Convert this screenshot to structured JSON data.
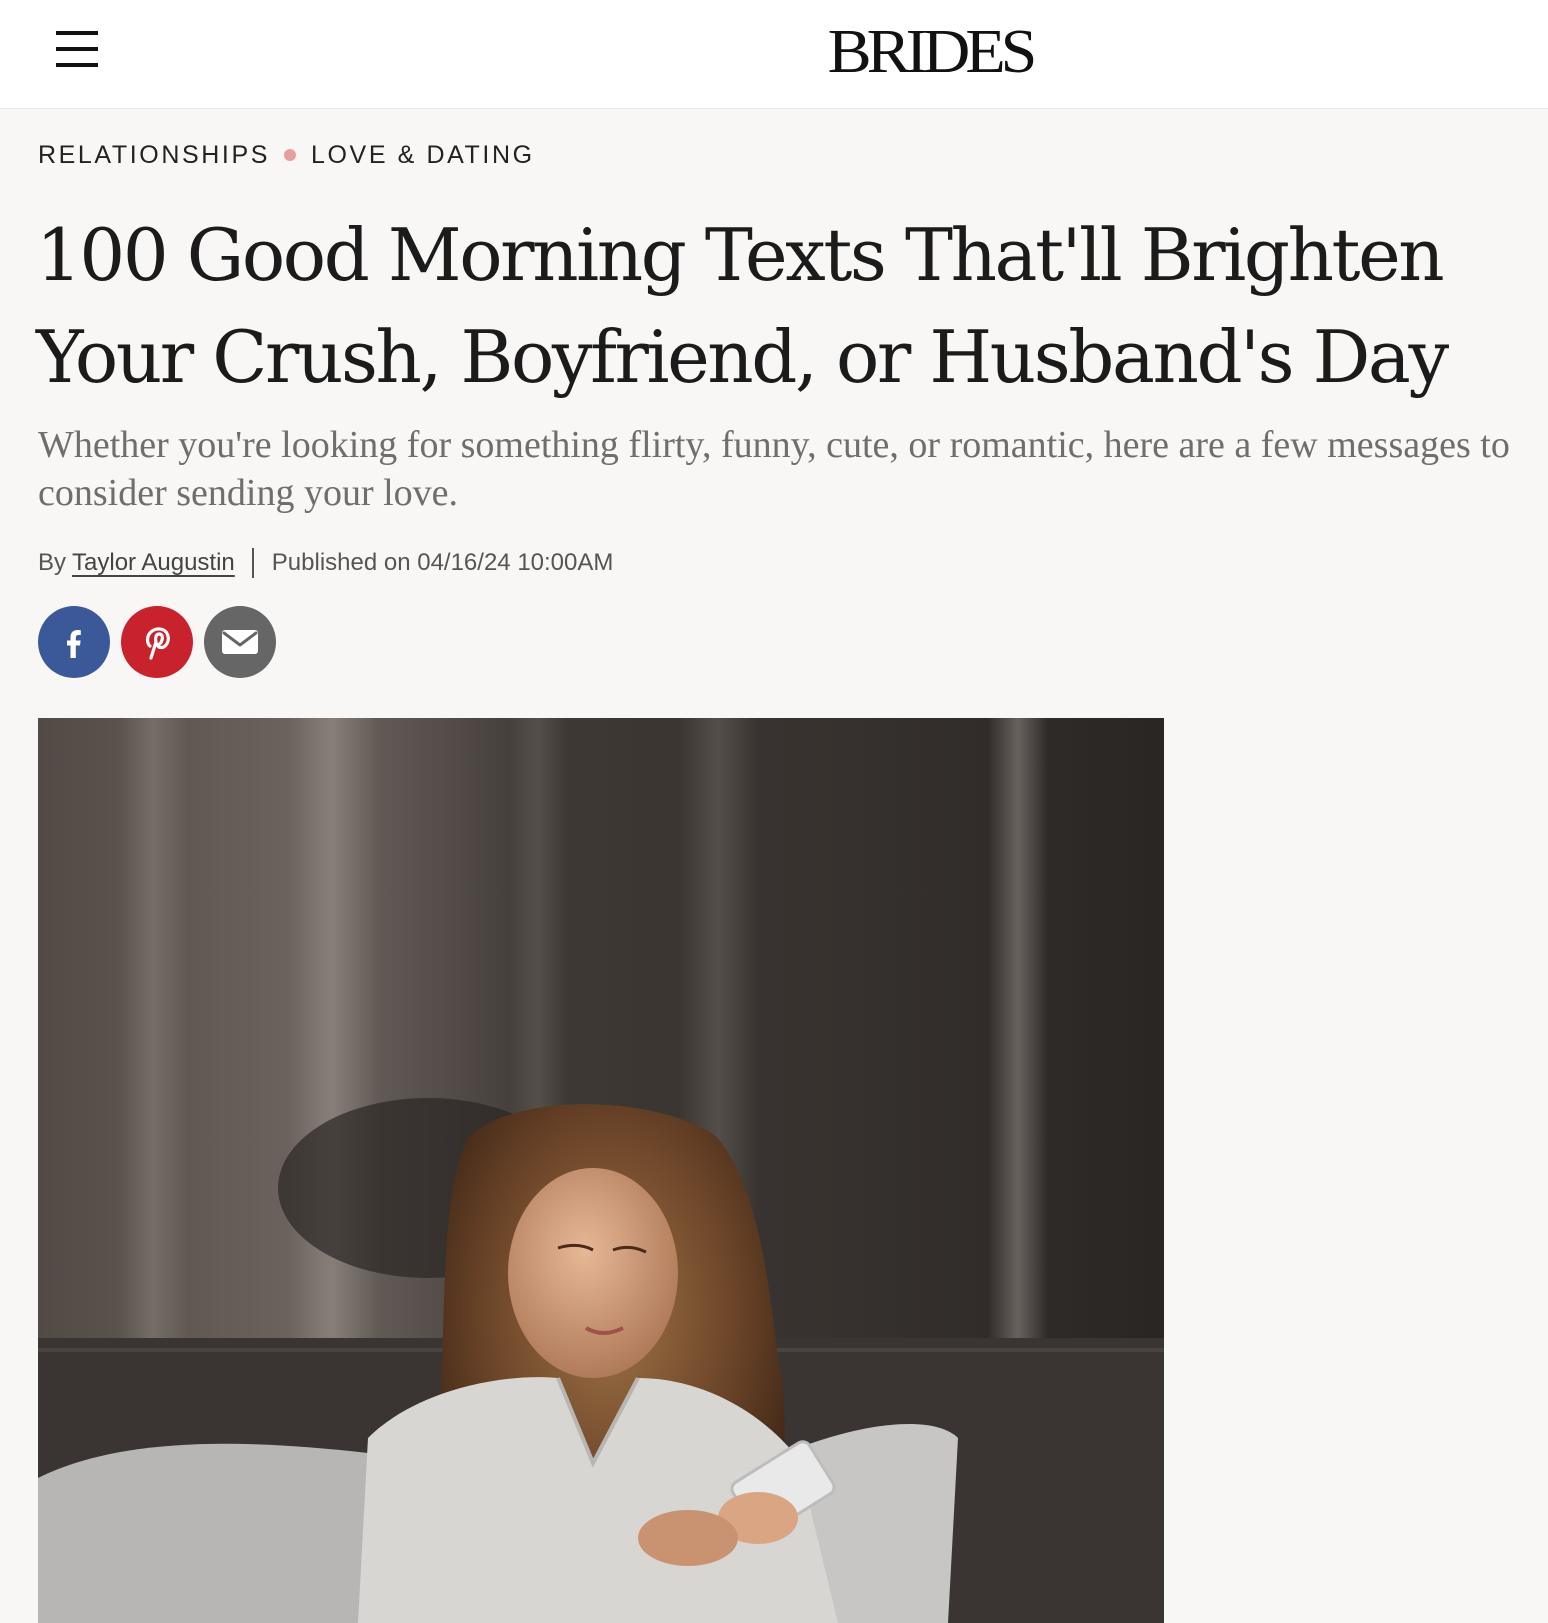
{
  "header": {
    "logo_text": "BRIDES",
    "menu_icon": "hamburger-menu-icon"
  },
  "breadcrumb": {
    "items": [
      "RELATIONSHIPS",
      "LOVE & DATING"
    ],
    "dot_color": "#e89e9e"
  },
  "article": {
    "title": "100 Good Morning Texts That'll Brighten Your Crush, Boyfriend, or Husband's Day",
    "subtitle": "Whether you're looking for something flirty, funny, cute, or romantic, here are a few messages to consider sending your love.",
    "byline": {
      "by": "By",
      "author": "Taylor Augustin",
      "published": "Published on 04/16/24 10:00AM"
    }
  },
  "social": {
    "buttons": [
      {
        "icon": "facebook-icon",
        "color": "#3b5998"
      },
      {
        "icon": "pinterest-icon",
        "color": "#c8232c"
      },
      {
        "icon": "email-icon",
        "color": "#666666"
      }
    ]
  },
  "hero_image": {
    "subject": "woman-in-bed-looking-at-phone-photo"
  }
}
